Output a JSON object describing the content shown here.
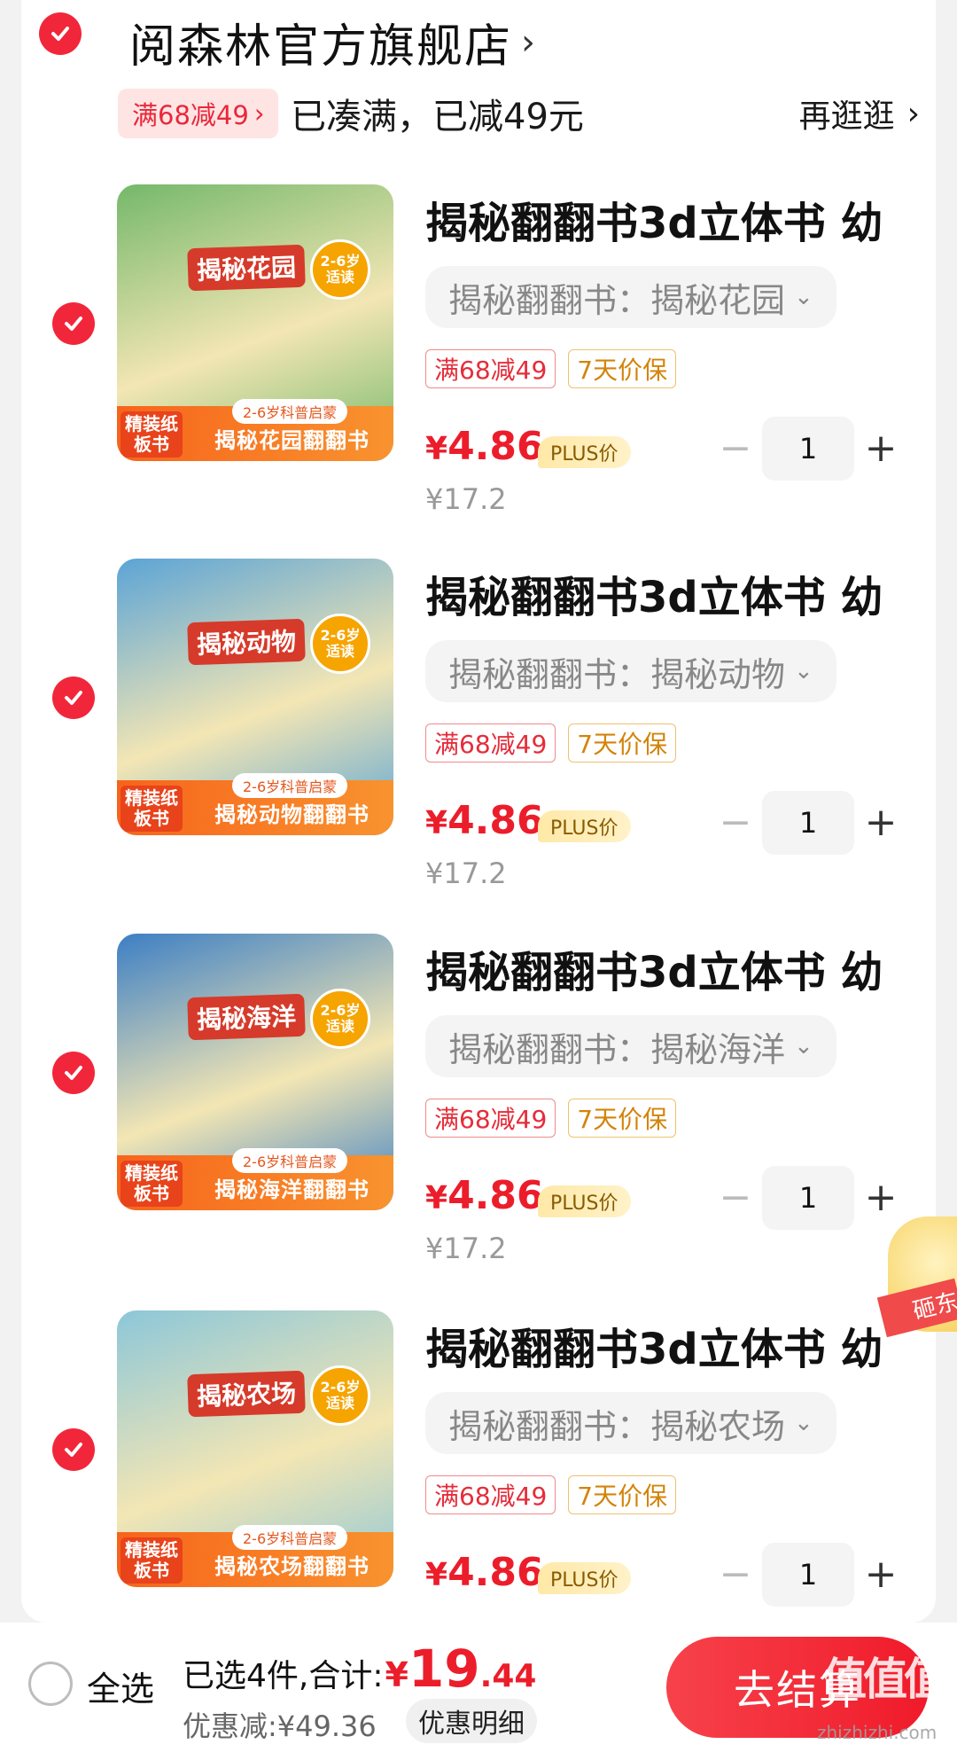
{
  "shop": {
    "name": "阅森林官方旗舰店",
    "chevron": "›"
  },
  "promo": {
    "tag": "满68减49",
    "tag_chevron": "›",
    "status": "已凑满，已减49元",
    "browse": "再逛逛",
    "browse_chevron": "›"
  },
  "items": [
    {
      "title": "揭秘翻翻书3d立体书 幼",
      "variant": "揭秘翻翻书：揭秘花园",
      "tag_discount": "满68减49",
      "tag_guarantee": "7天价保",
      "price_symbol": "¥",
      "price": "4.86",
      "plus_label": "PLUS价",
      "original_price": "¥17.2",
      "quantity": "1",
      "image": {
        "book_title": "揭秘花园",
        "band": "揭秘花园翻翻书",
        "age": "2-6岁",
        "age_sub": "适读",
        "age_band": "2-6岁科普启蒙",
        "hard": "精装纸板书",
        "color": "#74b86a"
      }
    },
    {
      "title": "揭秘翻翻书3d立体书 幼",
      "variant": "揭秘翻翻书：揭秘动物",
      "tag_discount": "满68减49",
      "tag_guarantee": "7天价保",
      "price_symbol": "¥",
      "price": "4.86",
      "plus_label": "PLUS价",
      "original_price": "¥17.2",
      "quantity": "1",
      "image": {
        "book_title": "揭秘动物",
        "band": "揭秘动物翻翻书",
        "age": "2-6岁",
        "age_sub": "适读",
        "age_band": "2-6岁科普启蒙",
        "hard": "精装纸板书",
        "color": "#5ba4d6"
      }
    },
    {
      "title": "揭秘翻翻书3d立体书 幼",
      "variant": "揭秘翻翻书：揭秘海洋",
      "tag_discount": "满68减49",
      "tag_guarantee": "7天价保",
      "price_symbol": "¥",
      "price": "4.86",
      "plus_label": "PLUS价",
      "original_price": "¥17.2",
      "quantity": "1",
      "image": {
        "book_title": "揭秘海洋",
        "band": "揭秘海洋翻翻书",
        "age": "2-6岁",
        "age_sub": "适读",
        "age_band": "2-6岁科普启蒙",
        "hard": "精装纸板书",
        "color": "#3c7fc4"
      }
    },
    {
      "title": "揭秘翻翻书3d立体书 幼",
      "variant": "揭秘翻翻书：揭秘农场",
      "tag_discount": "满68减49",
      "tag_guarantee": "7天价保",
      "price_symbol": "¥",
      "price": "4.86",
      "plus_label": "PLUS价",
      "quantity": "1",
      "image": {
        "book_title": "揭秘农场",
        "band": "揭秘农场翻翻书",
        "age": "2-6岁",
        "age_sub": "适读",
        "age_band": "2-6岁科普启蒙",
        "hard": "精装纸板书",
        "color": "#8cc7d9"
      }
    }
  ],
  "side_ribbon": "砸东",
  "footer": {
    "select_all": "全选",
    "selected": "已选4件,合计:",
    "total_symbol": "¥",
    "total_int": "19",
    "total_dec": ".44",
    "discount": "优惠减:¥49.36",
    "detail": "优惠明细",
    "checkout": "去结算",
    "watermark_logo": "值值值",
    "watermark_url": "zhizhizhi.com"
  },
  "colors": {
    "accent": "#ec1d2b",
    "check": "#f2263a",
    "background": "#f2f2f2"
  }
}
